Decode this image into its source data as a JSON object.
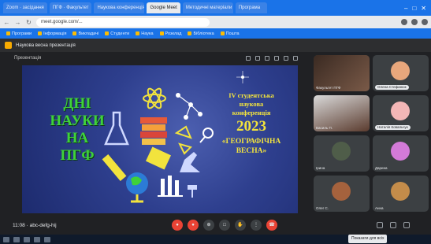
{
  "browser": {
    "tabs": [
      "Zoom · засідання",
      "ПГФ · Факультет",
      "Наукова конференція",
      "Google Meet",
      "Методичні матеріали",
      "Програма"
    ],
    "active_tab_index": 3,
    "url": "meet.google.com/...",
    "bookmarks": [
      "Програми",
      "Інформація",
      "Викладачі",
      "Студенти",
      "Наука",
      "Розклад",
      "Бібліотека",
      "Пошта"
    ]
  },
  "meeting": {
    "banner_title": "Наукова весна презентація",
    "presenter_label": "Презентація",
    "time": "11:08",
    "meeting_info": "· abc-defg-hij",
    "tooltip": "Показати для всіх"
  },
  "slide": {
    "left_lines": [
      "ДНІ",
      "НАУКИ",
      "НА",
      "ПГФ"
    ],
    "right_top": [
      "IV студентська",
      "наукова",
      "конференція"
    ],
    "year": "2023",
    "right_bottom": [
      "«ГЕОГРАФІЧНА",
      "ВЕСНА»"
    ],
    "colors": {
      "green": "#3fd23a",
      "yellow": "#f2e33d",
      "bg": "#2e3f8e"
    }
  },
  "participants": [
    {
      "name": "Факультет ПГФ",
      "kind": "video",
      "color": "#6b4a3a"
    },
    {
      "name": "Олена Стефанюк",
      "kind": "avatar",
      "color": "#e8a77c"
    },
    {
      "name": "Василь П.",
      "kind": "video",
      "color": "#5a3b2e"
    },
    {
      "name": "Наталія Ковальчук",
      "kind": "avatar",
      "color": "#f3b6b6"
    },
    {
      "name": "Ірина",
      "kind": "avatar",
      "color": "#4f5d49"
    },
    {
      "name": "Дарина",
      "kind": "avatar",
      "color": "#d37ad8"
    },
    {
      "name": "Олег С.",
      "kind": "avatar",
      "color": "#a5623d"
    },
    {
      "name": "Анна",
      "kind": "avatar",
      "color": "#c48c4a"
    }
  ]
}
